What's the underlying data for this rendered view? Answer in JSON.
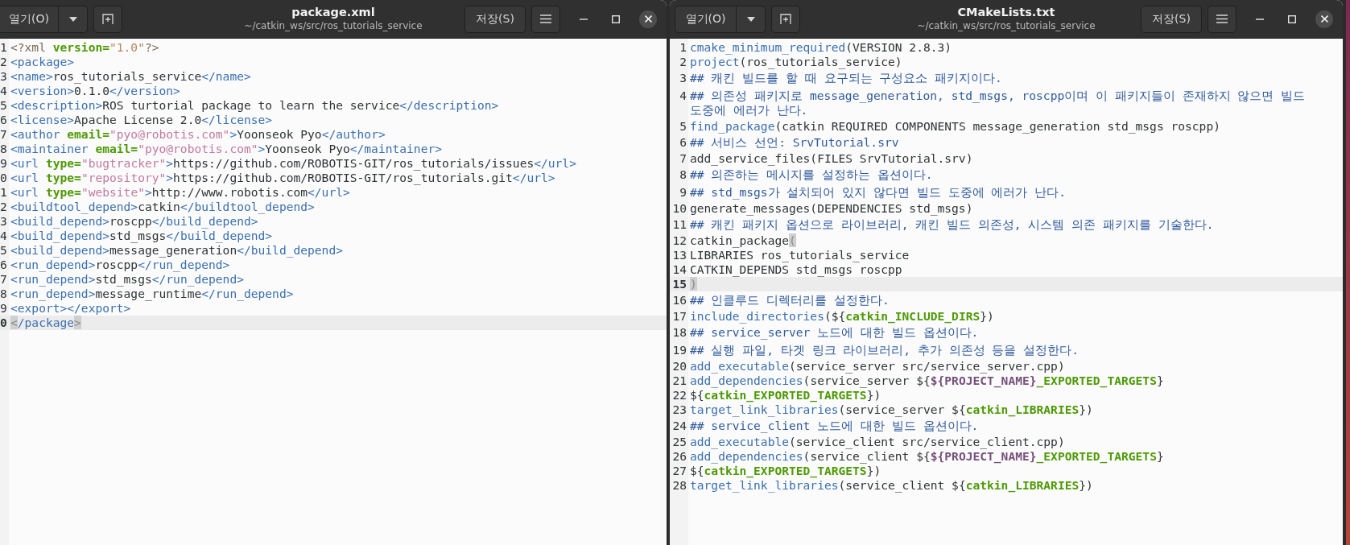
{
  "windows": [
    {
      "open_button": "열기(O)",
      "title": "package.xml",
      "subtitle": "~/catkin_ws/src/ros_tutorials_service",
      "save_button": "저장(S)",
      "numbers_cut": true,
      "lines": [
        {
          "number": "1",
          "current": false,
          "segments": [
            {
              "kind": "pi",
              "text": "<?xml "
            },
            {
              "kind": "attr",
              "text": "version="
            },
            {
              "kind": "value",
              "text": "\"1.0\""
            },
            {
              "kind": "pi",
              "text": "?>"
            }
          ]
        },
        {
          "number": "2",
          "current": false,
          "segments": [
            {
              "kind": "tag",
              "text": "<package>"
            }
          ]
        },
        {
          "number": "3",
          "current": false,
          "segments": [
            {
              "kind": "tag",
              "text": "<name>"
            },
            {
              "kind": "text",
              "text": "ros_tutorials_service"
            },
            {
              "kind": "tag",
              "text": "</name>"
            }
          ]
        },
        {
          "number": "4",
          "current": false,
          "segments": [
            {
              "kind": "tag",
              "text": "<version>"
            },
            {
              "kind": "text",
              "text": "0.1.0"
            },
            {
              "kind": "tag",
              "text": "</version>"
            }
          ]
        },
        {
          "number": "5",
          "current": false,
          "segments": [
            {
              "kind": "tag",
              "text": "<description>"
            },
            {
              "kind": "text",
              "text": "ROS turtorial package to learn the service"
            },
            {
              "kind": "tag",
              "text": "</description>"
            }
          ]
        },
        {
          "number": "6",
          "current": false,
          "segments": [
            {
              "kind": "tag",
              "text": "<license>"
            },
            {
              "kind": "text",
              "text": "Apache License 2.0"
            },
            {
              "kind": "tag",
              "text": "</license>"
            }
          ]
        },
        {
          "number": "7",
          "current": false,
          "segments": [
            {
              "kind": "tag",
              "text": "<author "
            },
            {
              "kind": "attr",
              "text": "email="
            },
            {
              "kind": "string",
              "text": "\"pyo@robotis.com\""
            },
            {
              "kind": "tag",
              "text": ">"
            },
            {
              "kind": "text",
              "text": "Yoonseok Pyo"
            },
            {
              "kind": "tag",
              "text": "</author>"
            }
          ]
        },
        {
          "number": "8",
          "current": false,
          "segments": [
            {
              "kind": "tag",
              "text": "<maintainer "
            },
            {
              "kind": "attr",
              "text": "email="
            },
            {
              "kind": "string",
              "text": "\"pyo@robotis.com\""
            },
            {
              "kind": "tag",
              "text": ">"
            },
            {
              "kind": "text",
              "text": "Yoonseok Pyo"
            },
            {
              "kind": "tag",
              "text": "</maintainer>"
            }
          ]
        },
        {
          "number": "9",
          "current": false,
          "segments": [
            {
              "kind": "tag",
              "text": "<url "
            },
            {
              "kind": "attr",
              "text": "type="
            },
            {
              "kind": "string",
              "text": "\"bugtracker\""
            },
            {
              "kind": "tag",
              "text": ">"
            },
            {
              "kind": "text",
              "text": "https://github.com/ROBOTIS-GIT/ros_tutorials/issues"
            },
            {
              "kind": "tag",
              "text": "</url>"
            }
          ]
        },
        {
          "number": "0",
          "current": false,
          "segments": [
            {
              "kind": "tag",
              "text": "<url "
            },
            {
              "kind": "attr",
              "text": "type="
            },
            {
              "kind": "string",
              "text": "\"repository\""
            },
            {
              "kind": "tag",
              "text": ">"
            },
            {
              "kind": "text",
              "text": "https://github.com/ROBOTIS-GIT/ros_tutorials.git"
            },
            {
              "kind": "tag",
              "text": "</url>"
            }
          ]
        },
        {
          "number": "1",
          "current": false,
          "segments": [
            {
              "kind": "tag",
              "text": "<url "
            },
            {
              "kind": "attr",
              "text": "type="
            },
            {
              "kind": "string",
              "text": "\"website\""
            },
            {
              "kind": "tag",
              "text": ">"
            },
            {
              "kind": "text",
              "text": "http://www.robotis.com"
            },
            {
              "kind": "tag",
              "text": "</url>"
            }
          ]
        },
        {
          "number": "2",
          "current": false,
          "segments": [
            {
              "kind": "tag",
              "text": "<buildtool_depend>"
            },
            {
              "kind": "text",
              "text": "catkin"
            },
            {
              "kind": "tag",
              "text": "</buildtool_depend>"
            }
          ]
        },
        {
          "number": "3",
          "current": false,
          "segments": [
            {
              "kind": "tag",
              "text": "<build_depend>"
            },
            {
              "kind": "text",
              "text": "roscpp"
            },
            {
              "kind": "tag",
              "text": "</build_depend>"
            }
          ]
        },
        {
          "number": "4",
          "current": false,
          "segments": [
            {
              "kind": "tag",
              "text": "<build_depend>"
            },
            {
              "kind": "text",
              "text": "std_msgs"
            },
            {
              "kind": "tag",
              "text": "</build_depend>"
            }
          ]
        },
        {
          "number": "5",
          "current": false,
          "segments": [
            {
              "kind": "tag",
              "text": "<build_depend>"
            },
            {
              "kind": "text",
              "text": "message_generation"
            },
            {
              "kind": "tag",
              "text": "</build_depend>"
            }
          ]
        },
        {
          "number": "6",
          "current": false,
          "segments": [
            {
              "kind": "tag",
              "text": "<run_depend>"
            },
            {
              "kind": "text",
              "text": "roscpp"
            },
            {
              "kind": "tag",
              "text": "</run_depend>"
            }
          ]
        },
        {
          "number": "7",
          "current": false,
          "segments": [
            {
              "kind": "tag",
              "text": "<run_depend>"
            },
            {
              "kind": "text",
              "text": "std_msgs"
            },
            {
              "kind": "tag",
              "text": "</run_depend>"
            }
          ]
        },
        {
          "number": "8",
          "current": false,
          "segments": [
            {
              "kind": "tag",
              "text": "<run_depend>"
            },
            {
              "kind": "text",
              "text": "message_runtime"
            },
            {
              "kind": "tag",
              "text": "</run_depend>"
            }
          ]
        },
        {
          "number": "9",
          "current": false,
          "segments": [
            {
              "kind": "tag",
              "text": "<export></export>"
            }
          ]
        },
        {
          "number": "0",
          "current": true,
          "segments": [
            {
              "kind": "match",
              "text": "<"
            },
            {
              "kind": "tag",
              "text": "/package"
            },
            {
              "kind": "match",
              "text": ">"
            }
          ]
        }
      ]
    },
    {
      "open_button": "열기(O)",
      "title": "CMakeLists.txt",
      "subtitle": "~/catkin_ws/src/ros_tutorials_service",
      "save_button": "저장(S)",
      "numbers_cut": false,
      "lines": [
        {
          "number": "1",
          "current": false,
          "segments": [
            {
              "kind": "cmd",
              "text": "cmake_minimum_required"
            },
            {
              "kind": "text",
              "text": "(VERSION 2.8.3)"
            }
          ]
        },
        {
          "number": "2",
          "current": false,
          "segments": [
            {
              "kind": "cmd",
              "text": "project"
            },
            {
              "kind": "text",
              "text": "(ros_tutorials_service)"
            }
          ]
        },
        {
          "number": "3",
          "current": false,
          "segments": [
            {
              "kind": "comment",
              "text": "## 캐킨 빌드를 할 때 요구되는 구성요소 패키지이다."
            }
          ]
        },
        {
          "number": "4",
          "current": false,
          "segments": [
            {
              "kind": "comment",
              "text": "## 의존성 패키지로 message_generation, std_msgs, roscpp이며 이 패키지들이 존재하지 않으면 빌드 도중에 에러가 난다."
            }
          ]
        },
        {
          "number": "5",
          "current": false,
          "segments": [
            {
              "kind": "cmd",
              "text": "find_package"
            },
            {
              "kind": "text",
              "text": "(catkin REQUIRED COMPONENTS message_generation std_msgs roscpp)"
            }
          ]
        },
        {
          "number": "6",
          "current": false,
          "segments": [
            {
              "kind": "comment",
              "text": "## 서비스 선언: SrvTutorial.srv"
            }
          ]
        },
        {
          "number": "7",
          "current": false,
          "segments": [
            {
              "kind": "text",
              "text": "add_service_files(FILES SrvTutorial.srv)"
            }
          ]
        },
        {
          "number": "8",
          "current": false,
          "segments": [
            {
              "kind": "comment",
              "text": "## 의존하는 메시지를 설정하는 옵션이다."
            }
          ]
        },
        {
          "number": "9",
          "current": false,
          "segments": [
            {
              "kind": "comment",
              "text": "## std_msgs가 설치되어 있지 않다면 빌드 도중에 에러가 난다."
            }
          ]
        },
        {
          "number": "10",
          "current": false,
          "segments": [
            {
              "kind": "text",
              "text": "generate_messages(DEPENDENCIES std_msgs)"
            }
          ]
        },
        {
          "number": "11",
          "current": false,
          "segments": [
            {
              "kind": "comment",
              "text": "## 캐킨 패키지 옵션으로 라이브러리, 캐킨 빌드 의존성, 시스템 의존 패키지를 기술한다."
            }
          ]
        },
        {
          "number": "12",
          "current": false,
          "segments": [
            {
              "kind": "text",
              "text": "catkin_package"
            },
            {
              "kind": "match",
              "text": "("
            }
          ]
        },
        {
          "number": "13",
          "current": false,
          "segments": [
            {
              "kind": "text",
              "text": "LIBRARIES ros_tutorials_service"
            }
          ]
        },
        {
          "number": "14",
          "current": false,
          "segments": [
            {
              "kind": "text",
              "text": "CATKIN_DEPENDS std_msgs roscpp"
            }
          ]
        },
        {
          "number": "15",
          "current": true,
          "segments": [
            {
              "kind": "match",
              "text": ")"
            }
          ]
        },
        {
          "number": "16",
          "current": false,
          "segments": [
            {
              "kind": "comment",
              "text": "## 인클루드 디렉터리를 설정한다."
            }
          ]
        },
        {
          "number": "17",
          "current": false,
          "segments": [
            {
              "kind": "cmd",
              "text": "include_directories"
            },
            {
              "kind": "text",
              "text": "(${"
            },
            {
              "kind": "var",
              "text": "catkin_INCLUDE_DIRS"
            },
            {
              "kind": "text",
              "text": "})"
            }
          ]
        },
        {
          "number": "18",
          "current": false,
          "segments": [
            {
              "kind": "comment",
              "text": "## service_server 노드에 대한 빌드 옵션이다."
            }
          ]
        },
        {
          "number": "19",
          "current": false,
          "segments": [
            {
              "kind": "comment",
              "text": "## 실행 파일, 타겟 링크 라이브러리, 추가 의존성 등을 설정한다."
            }
          ]
        },
        {
          "number": "20",
          "current": false,
          "segments": [
            {
              "kind": "cmd",
              "text": "add_executable"
            },
            {
              "kind": "text",
              "text": "(service_server src/service_server.cpp)"
            }
          ]
        },
        {
          "number": "21",
          "current": false,
          "segments": [
            {
              "kind": "cmd",
              "text": "add_dependencies"
            },
            {
              "kind": "text",
              "text": "(service_server ${"
            },
            {
              "kind": "macro",
              "text": "${PROJECT_NAME}"
            },
            {
              "kind": "var",
              "text": "_EXPORTED_TARGETS"
            },
            {
              "kind": "text",
              "text": "}"
            }
          ]
        },
        {
          "number": "22",
          "current": false,
          "segments": [
            {
              "kind": "text",
              "text": "${"
            },
            {
              "kind": "var",
              "text": "catkin_EXPORTED_TARGETS"
            },
            {
              "kind": "text",
              "text": "})"
            }
          ]
        },
        {
          "number": "23",
          "current": false,
          "segments": [
            {
              "kind": "cmd",
              "text": "target_link_libraries"
            },
            {
              "kind": "text",
              "text": "(service_server ${"
            },
            {
              "kind": "var",
              "text": "catkin_LIBRARIES"
            },
            {
              "kind": "text",
              "text": "})"
            }
          ]
        },
        {
          "number": "24",
          "current": false,
          "segments": [
            {
              "kind": "comment",
              "text": "## service_client 노드에 대한 빌드 옵션이다."
            }
          ]
        },
        {
          "number": "25",
          "current": false,
          "segments": [
            {
              "kind": "cmd",
              "text": "add_executable"
            },
            {
              "kind": "text",
              "text": "(service_client src/service_client.cpp)"
            }
          ]
        },
        {
          "number": "26",
          "current": false,
          "segments": [
            {
              "kind": "cmd",
              "text": "add_dependencies"
            },
            {
              "kind": "text",
              "text": "(service_client ${"
            },
            {
              "kind": "macro",
              "text": "${PROJECT_NAME}"
            },
            {
              "kind": "var",
              "text": "_EXPORTED_TARGETS"
            },
            {
              "kind": "text",
              "text": "}"
            }
          ]
        },
        {
          "number": "27",
          "current": false,
          "segments": [
            {
              "kind": "text",
              "text": "${"
            },
            {
              "kind": "var",
              "text": "catkin_EXPORTED_TARGETS"
            },
            {
              "kind": "text",
              "text": "})"
            }
          ]
        },
        {
          "number": "28",
          "current": false,
          "segments": [
            {
              "kind": "cmd",
              "text": "target_link_libraries"
            },
            {
              "kind": "text",
              "text": "(service_client ${"
            },
            {
              "kind": "var",
              "text": "catkin_LIBRARIES"
            },
            {
              "kind": "text",
              "text": "})"
            }
          ]
        }
      ]
    }
  ]
}
